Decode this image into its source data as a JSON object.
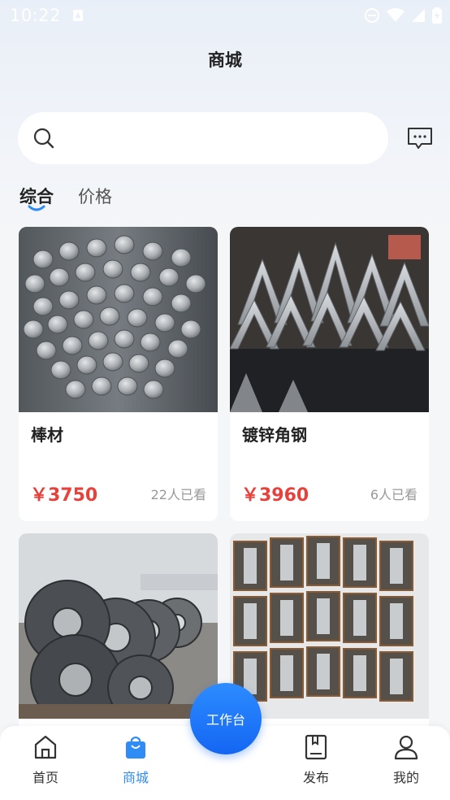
{
  "status_bar": {
    "time": "10:22"
  },
  "header": {
    "title": "商城"
  },
  "search": {
    "placeholder": ""
  },
  "filter_tabs": [
    {
      "label": "综合",
      "active": true
    },
    {
      "label": "价格",
      "active": false
    }
  ],
  "products": [
    {
      "name": "棒材",
      "price": "￥3750",
      "views": "22人已看",
      "image": "steel-bars-photo"
    },
    {
      "name": "镀锌角钢",
      "price": "￥3960",
      "views": "6人已看",
      "image": "galvanized-angle-steel-photo"
    },
    {
      "name": "",
      "price": "",
      "views": "",
      "image": "steel-coils-photo"
    },
    {
      "name": "",
      "price": "",
      "views": "",
      "image": "i-beam-stack-photo"
    }
  ],
  "fab": {
    "label": "工作台"
  },
  "tabbar": [
    {
      "label": "首页",
      "icon": "home-icon",
      "active": false
    },
    {
      "label": "商城",
      "icon": "shopping-bag-icon",
      "active": true
    },
    {
      "label": "发布",
      "icon": "publish-book-icon",
      "active": false
    },
    {
      "label": "我的",
      "icon": "profile-icon",
      "active": false
    }
  ],
  "colors": {
    "accent": "#2f8cf5",
    "price": "#e8413c",
    "fab_top": "#2d8cff",
    "fab_bottom": "#1466f2"
  }
}
